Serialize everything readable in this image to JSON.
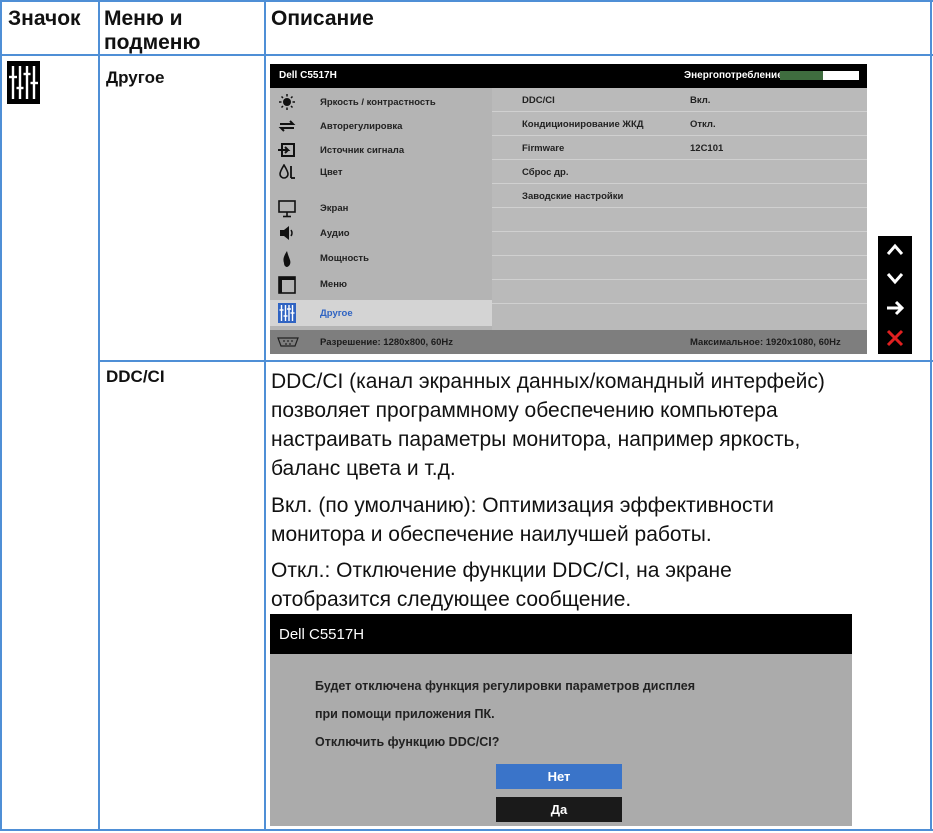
{
  "header": {
    "col_icon": "Значок",
    "col_menu_line1": "Меню и",
    "col_menu_line2": "подменю",
    "col_desc": "Описание"
  },
  "row_other": {
    "menu_name": "Другое",
    "icon": "sliders-icon"
  },
  "osd": {
    "title": "Dell C5517H",
    "energy_label": "Энергопотребление",
    "energy_level": 0.55,
    "menu": [
      {
        "label": "Яркость / контрастность",
        "icon": "brightness-icon"
      },
      {
        "label": "Авторегулировка",
        "icon": "auto-adjust-icon"
      },
      {
        "label": "Источник сигнала",
        "icon": "input-source-icon"
      },
      {
        "label": "Цвет",
        "icon": "color-icon"
      },
      {
        "label": "Экран",
        "icon": "display-icon"
      },
      {
        "label": "Аудио",
        "icon": "speaker-icon"
      },
      {
        "label": "Мощность",
        "icon": "power-icon"
      },
      {
        "label": "Меню",
        "icon": "menu-icon"
      },
      {
        "label": "Другое",
        "icon": "sliders-icon"
      }
    ],
    "submenu": [
      {
        "key": "DDC/CI",
        "value": "Вкл."
      },
      {
        "key": "Кондиционирование ЖКД",
        "value": "Откл."
      },
      {
        "key": "Firmware",
        "value": "12C101"
      },
      {
        "key": "Сброс др.",
        "value": ""
      },
      {
        "key": "Заводские настройки",
        "value": ""
      }
    ],
    "resolution": "Разрешение: 1280x800, 60Hz",
    "max_resolution": "Максимальное: 1920x1080, 60Hz",
    "nav_buttons": [
      "up-arrow-icon",
      "down-arrow-icon",
      "right-arrow-icon",
      "close-icon"
    ],
    "colors": {
      "active_text": "#2f63c2",
      "energy_fill": "#3f6d3f",
      "close": "#e02020"
    }
  },
  "row_ddc": {
    "name": "DDC/CI",
    "p1": [
      "DDC/CI (канал экранных данных/командный интерфейс)",
      "позволяет программному обеспечению компьютера",
      "настраивать параметры монитора, например яркость,",
      "баланс цвета и т.д."
    ],
    "p2": [
      "Вкл. (по умолчанию): Оптимизация эффективности",
      "монитора и обеспечение наилучшей работы."
    ],
    "p3": [
      "Откл.: Отключение функции DDC/CI, на экране",
      "отобразится следующее сообщение."
    ]
  },
  "dialog": {
    "title": "Dell C5517H",
    "line1": "Будет отключена функция регулировки параметров дисплея",
    "line2": "при помощи приложения ПК.",
    "line3": "Отключить функцию DDC/CI?",
    "no_label": "Нет",
    "yes_label": "Да"
  }
}
